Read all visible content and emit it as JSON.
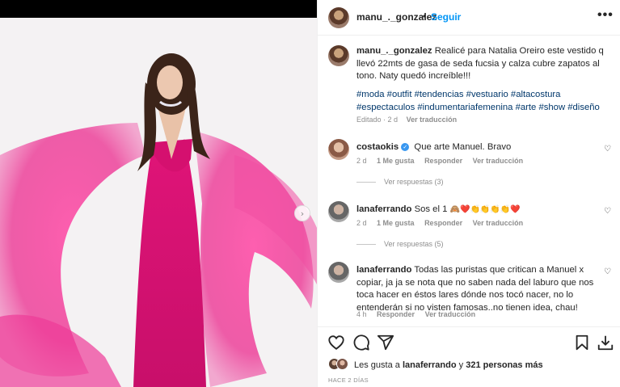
{
  "post_image": {
    "alt_colors": {
      "background": "#f4f2f3",
      "dress": "#e0157b"
    },
    "next_icon": "chevron-right-icon"
  },
  "header": {
    "username": "manu_._gonzalez",
    "separator": "•",
    "follow_label": "Seguir",
    "more_icon": "more-horizontal-icon",
    "more_label": "•••"
  },
  "caption": {
    "username": "manu_._gonzalez",
    "text": "Realicé para Natalia Oreiro este vestido q llevó 22mts de gasa de seda fucsia y calza cubre zapatos al tono. Naty quedó increíble!!!",
    "hashtags": "#moda #outfit #tendencias #vestuario #altacostura #espectaculos #indumentariafemenina #arte #show #diseño",
    "edited": "Editado · 2 d",
    "see_translation": "Ver traducción"
  },
  "comments": [
    {
      "username": "costaokis",
      "verified": true,
      "text": "Que arte Manuel. Bravo",
      "age": "2 d",
      "likes": "1 Me gusta",
      "reply": "Responder",
      "translate": "Ver traducción",
      "view_replies": "Ver respuestas (3)"
    },
    {
      "username": "lanaferrando",
      "verified": false,
      "text": "Sos el 1",
      "emojis": "🙈❤️👏👏👏👏❤️",
      "age": "2 d",
      "likes": "1 Me gusta",
      "reply": "Responder",
      "translate": "Ver traducción",
      "view_replies": "Ver respuestas (5)"
    },
    {
      "username": "lanaferrando",
      "verified": false,
      "text": "Todas las puristas que critican a Manuel x copiar, ja ja se nota que no saben nada del laburo que nos toca hacer en éstos lares dónde nos tocó nacer, no lo entenderán si no visten famosas..no tienen idea, chau!",
      "age": "4 h",
      "reply": "Responder",
      "translate": "Ver traducción"
    }
  ],
  "actions": {
    "like_icon": "heart-icon",
    "comment_icon": "comment-icon",
    "share_icon": "send-icon",
    "save_icon": "bookmark-icon",
    "download_icon": "download-icon"
  },
  "likes": {
    "prefix": "Les gusta a",
    "user": "lanaferrando",
    "conj": "y",
    "others": "321 personas más"
  },
  "timestamp": "HACE 2 DÍAS"
}
